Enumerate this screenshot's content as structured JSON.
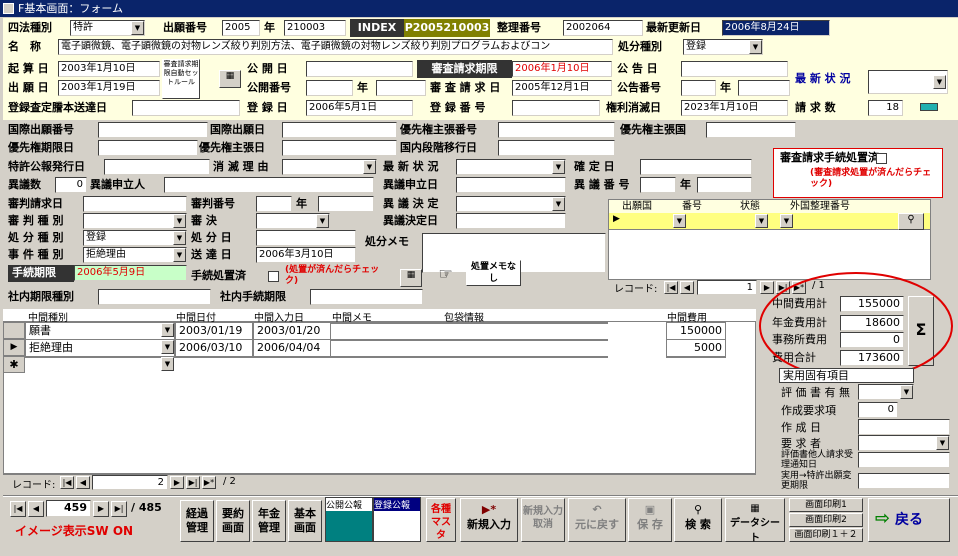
{
  "window": {
    "title": "F基本画面：フォーム"
  },
  "header": {
    "shiho_label": "四法種別",
    "shiho_value": "特許",
    "shutsugan_label": "出願番号",
    "shutsugan_era": "2005",
    "nen": "年",
    "shutsugan_no": "210003",
    "index_label": "INDEX",
    "index_value": "P2005210003",
    "seiri_label": "整理番号",
    "seiri_value": "2002064",
    "saishin_label": "最新更新日",
    "saishin_value": "2006年8月24日",
    "name_label": "名　称",
    "name_value": "電子顕微鏡、電子顕微鏡の対物レンズ絞り判別方法、電子顕微鏡の対物レンズ絞り判別プログラムおよびコン",
    "shobun_label": "処分種別",
    "shobun_value": "登録",
    "kian_label": "起 算 日",
    "kian_value": "2003年1月10日",
    "shinsa_btn": "審査請求期限自動セットルール",
    "kokai_label": "公 開 日",
    "kokai_value": "",
    "shinsa_kigen_label": "審査請求期限",
    "shinsa_kigen_value": "2006年1月10日",
    "kokoku_label": "公 告 日",
    "kokoku_value": "",
    "saishin_jokyo_label": "最 新 状 況",
    "saishin_jokyo_value": "",
    "shutsugan_bi_label": "出 願 日",
    "shutsugan_bi_value": "2003年1月19日",
    "kokai_no_label": "公開番号",
    "kokai_nen": "年",
    "shinsa_seikyu_label": "審 査 請 求 日",
    "shinsa_seikyu_value": "2005年12月1日",
    "kokoku_no_label": "公告番号",
    "kokoku_nen": "年",
    "sateitei_label": "登録査定謄本送達日",
    "sateitei_value": "",
    "toroku_bi_label": "登 録 日",
    "toroku_bi_value": "2006年5月1日",
    "toroku_no_label": "登 録 番 号",
    "toroku_no_value": "",
    "kenri_label": "権利消滅日",
    "kenri_value": "2023年1月10日",
    "seikyu_su_label": "請 求 数",
    "seikyu_su_value": "18"
  },
  "mid": {
    "kokusai_no": "国際出願番号",
    "kokusai_bi": "国際出願日",
    "yusen_no": "優先権主張番号",
    "yusen_koku": "優先権主張国",
    "yusen_kigen": "優先権期限日",
    "yusen_bi": "優先権主張日",
    "kokunai": "国内段階移行日",
    "tokkyo_koho": "特許公報発行日",
    "shometsu": "消 滅 理 由",
    "saishin_jokyo2": "最 新 状 況",
    "kakutei": "確 定 日",
    "igi_su": "異議数",
    "igi_su_value": "0",
    "igi_moshitate": "異議申立人",
    "igi_moshitate_bi": "異議申立日",
    "igi_no": "異 議 番 号",
    "igi_nen": "年",
    "shinpan_seikyu": "審判請求日",
    "shinpan_no": "審判番号",
    "shinpan_nen": "年",
    "igi_kettei": "異 議 決 定",
    "shinpan_shubetsu": "審 判 種 別",
    "shinketsu": "審 決",
    "igi_kettei_bi": "異議決定日",
    "shobun_shubetsu": "処 分 種 別",
    "shobun_shubetsu_value": "登録",
    "shobun_bi": "処 分 日",
    "shobun_memo": "処分メモ",
    "jiken_shubetsu": "事 件 種 別",
    "jiken_shubetsu_value": "拒絶理由",
    "sotatsu_bi": "送 達 日",
    "sotatsu_value": "2006年3月10日",
    "tetsuzuki_kigen": "手続期限",
    "tetsuzuki_kigen_value": "2006年5月9日",
    "tetsuzuki_shochi": "手続処置済",
    "tetsuzuki_note": "(処置が済んだらチェック)",
    "shochi_btn": "処置メモなし",
    "shanai_kigen": "社内期限種別",
    "shanai_tetsuzuki": "社内手続期限",
    "shinsa_box_title": "審査請求手続処置済",
    "shinsa_box_note": "(審査請求処置が済んだらチェック)"
  },
  "foreign": {
    "headers": [
      "出願国",
      "番号",
      "状態",
      "外国整理番号"
    ],
    "record_label": "レコード:",
    "current": "1",
    "total": "/ 1"
  },
  "midterm": {
    "headers": [
      "中間種別",
      "中間日付",
      "中間入力日",
      "中間メモ",
      "包袋情報",
      "中間費用"
    ],
    "rows": [
      {
        "type": "願書",
        "date": "2003/01/19",
        "input": "2003/01/20",
        "memo": "",
        "info": "",
        "cost": "150000"
      },
      {
        "type": "拒絶理由",
        "date": "2006/03/10",
        "input": "2006/04/04",
        "memo": "",
        "info": "",
        "cost": "5000"
      }
    ],
    "record_label": "レコード:",
    "current": "2",
    "total": "/ 2"
  },
  "costs": {
    "items": [
      {
        "label": "中間費用計",
        "value": "155000"
      },
      {
        "label": "年金費用計",
        "value": "18600"
      },
      {
        "label": "事務所費用",
        "value": "0"
      },
      {
        "label": "費用合計",
        "value": "173600"
      }
    ],
    "sigma": "Σ"
  },
  "jitsuyo": {
    "title": "実用固有項目",
    "hyoka": "評 価 書 有 無",
    "sakusei_yokyu": "作成要求項",
    "sakusei_yokyu_value": "0",
    "sakusei_bi": "作 成 日",
    "yokyusha": "要 求 者",
    "note1": "評価書他人請求受理通知日",
    "note2": "実用→特許出願変更期限"
  },
  "bottom": {
    "record_current": "459",
    "record_total": "/ 485",
    "image_sw": "イメージ表示SW ON",
    "buttons": [
      {
        "label": "経過管理"
      },
      {
        "label": "要約画面"
      },
      {
        "label": "年金管理"
      },
      {
        "label": "基本画面"
      }
    ],
    "kokai_koho": "公開公報",
    "toroku_koho": "登録公報",
    "kakushu": "各種マスタ",
    "new_input": "新規入力",
    "new_cancel": "新規入力取消",
    "undo": "元に戻す",
    "save": "保 存",
    "search": "検 索",
    "datasheet": "データシート",
    "print1": "画面印刷1",
    "print2": "画面印刷2",
    "print12": "画面印刷１＋２",
    "back": "戻る"
  },
  "colors": {
    "yellow_panel": "#ffffe0",
    "index_bg": "#808000",
    "title_bg": "#0a246a",
    "red_ellipse": "#e00000"
  }
}
